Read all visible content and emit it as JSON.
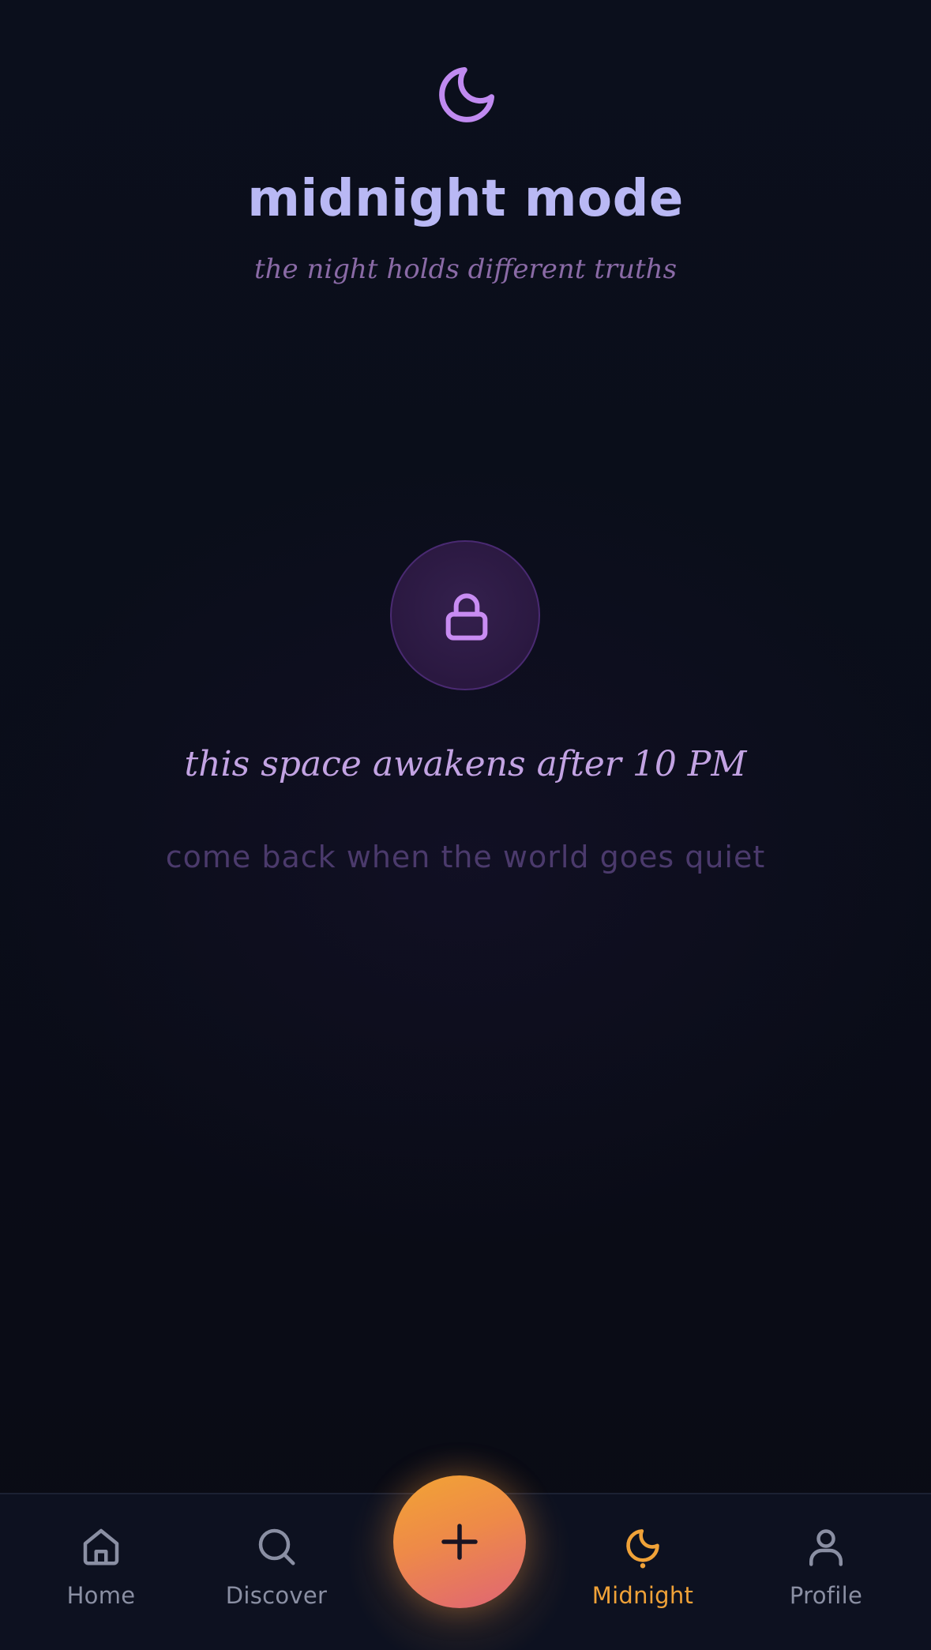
{
  "header": {
    "icon": "moon-icon",
    "title": "midnight mode",
    "subtitle": "the night holds different truths"
  },
  "locked_state": {
    "icon": "lock-icon",
    "headline": "this space awakens after 10 PM",
    "subtext": "come back when the world goes quiet"
  },
  "bottom_nav": {
    "items": [
      {
        "label": "Home",
        "icon": "home-icon",
        "active": false
      },
      {
        "label": "Discover",
        "icon": "search-icon",
        "active": false
      },
      {
        "label": "Midnight",
        "icon": "moon-icon",
        "active": true
      },
      {
        "label": "Profile",
        "icon": "user-icon",
        "active": false
      }
    ],
    "fab_icon": "plus-icon"
  },
  "colors": {
    "background": "#0a0d18",
    "title": "#b9b8f4",
    "accent_purple": "#c08af0",
    "accent_orange": "#f0a238",
    "inactive_nav": "#8a8fa3"
  }
}
